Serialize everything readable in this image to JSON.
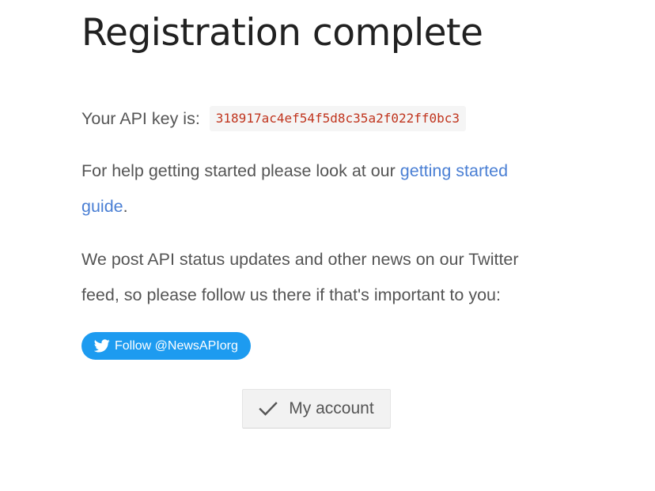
{
  "page": {
    "title": "Registration complete"
  },
  "api": {
    "label": "Your API key is:",
    "key": "318917ac4ef54f5d8c35a2f022ff0bc3"
  },
  "help": {
    "text_before": "For help getting started please look at our ",
    "link_text": "getting started guide",
    "text_after": "."
  },
  "news": {
    "text": "We post API status updates and other news on our Twitter feed, so please follow us there if that's important to you:"
  },
  "twitter": {
    "follow_label": "Follow @NewsAPIorg",
    "icon": "twitter-bird-icon",
    "color": "#1d9bf0"
  },
  "account": {
    "button_label": "My account",
    "icon": "checkmark-icon"
  },
  "colors": {
    "link": "#4a7fd4",
    "api_key_text": "#c0341d"
  }
}
